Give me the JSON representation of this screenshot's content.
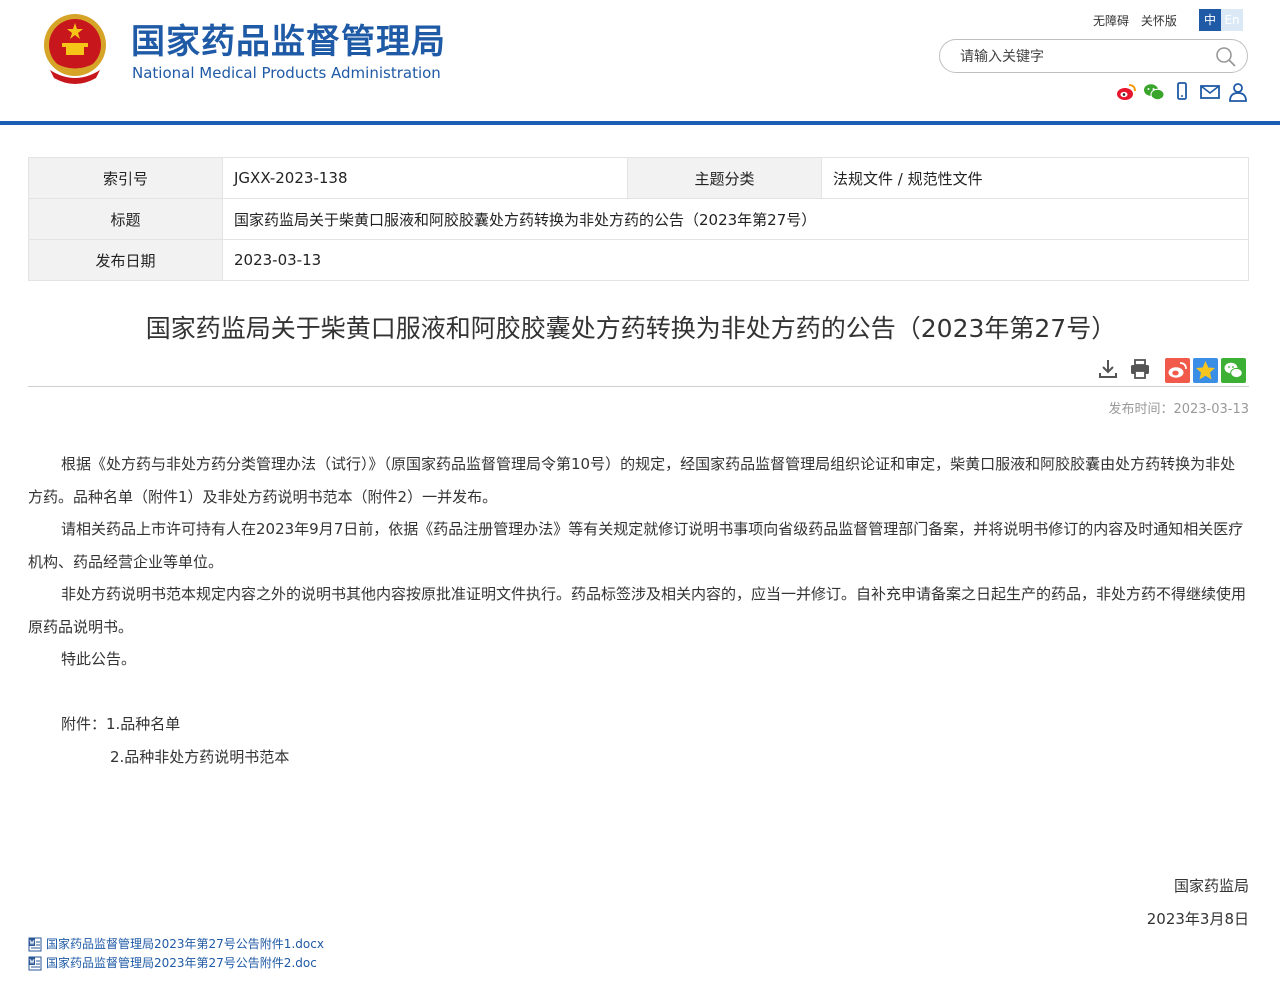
{
  "header": {
    "title_cn": "国家药品监督管理局",
    "title_en": "National Medical Products Administration",
    "links": [
      "无障碍",
      "关怀版"
    ],
    "lang": {
      "cn": "中",
      "en": "En"
    },
    "search_placeholder": "请输入关键字",
    "social_icons": [
      "weibo-icon",
      "wechat-icon",
      "mobile-icon",
      "mail-icon",
      "user-icon"
    ],
    "colors": {
      "brand": "#1f5aa6",
      "bar": "#1a5fb4"
    }
  },
  "info": {
    "index_label": "索引号",
    "index_value": "JGXX-2023-138",
    "category_label": "主题分类",
    "category_value": "法规文件 / 规范性文件",
    "title_label": "标题",
    "title_value": "国家药监局关于柴黄口服液和阿胶胶囊处方药转换为非处方药的公告（2023年第27号）",
    "date_label": "发布日期",
    "date_value": "2023-03-13"
  },
  "article": {
    "title": "国家药监局关于柴黄口服液和阿胶胶囊处方药转换为非处方药的公告（2023年第27号）",
    "pub_time": "发布时间：2023-03-13",
    "paragraphs": [
      "根据《处方药与非处方药分类管理办法（试行）》（原国家药品监督管理局令第10号）的规定，经国家药品监督管理局组织论证和审定，柴黄口服液和阿胶胶囊由处方药转换为非处方药。品种名单（附件1）及非处方药说明书范本（附件2）一并发布。",
      "请相关药品上市许可持有人在2023年9月7日前，依据《药品注册管理办法》等有关规定就修订说明书事项向省级药品监督管理部门备案，并将说明书修订的内容及时通知相关医疗机构、药品经营企业等单位。",
      "非处方药说明书范本规定内容之外的说明书其他内容按原批准证明文件执行。药品标签涉及相关内容的，应当一并修订。自补充申请备案之日起生产的药品，非处方药不得继续使用原药品说明书。",
      "特此公告。"
    ],
    "attachment_1": "附件：1.品种名单",
    "attachment_2": "2.品种非处方药说明书范本",
    "signer": "国家药监局",
    "sign_date": "2023年3月8日",
    "tool_icons": [
      "download-icon",
      "print-icon"
    ],
    "share_icons": [
      "weibo-share-icon",
      "qzone-share-icon",
      "wechat-share-icon"
    ]
  },
  "files": [
    "国家药品监督管理局2023年第27号公告附件1.docx",
    "国家药品监督管理局2023年第27号公告附件2.doc"
  ]
}
